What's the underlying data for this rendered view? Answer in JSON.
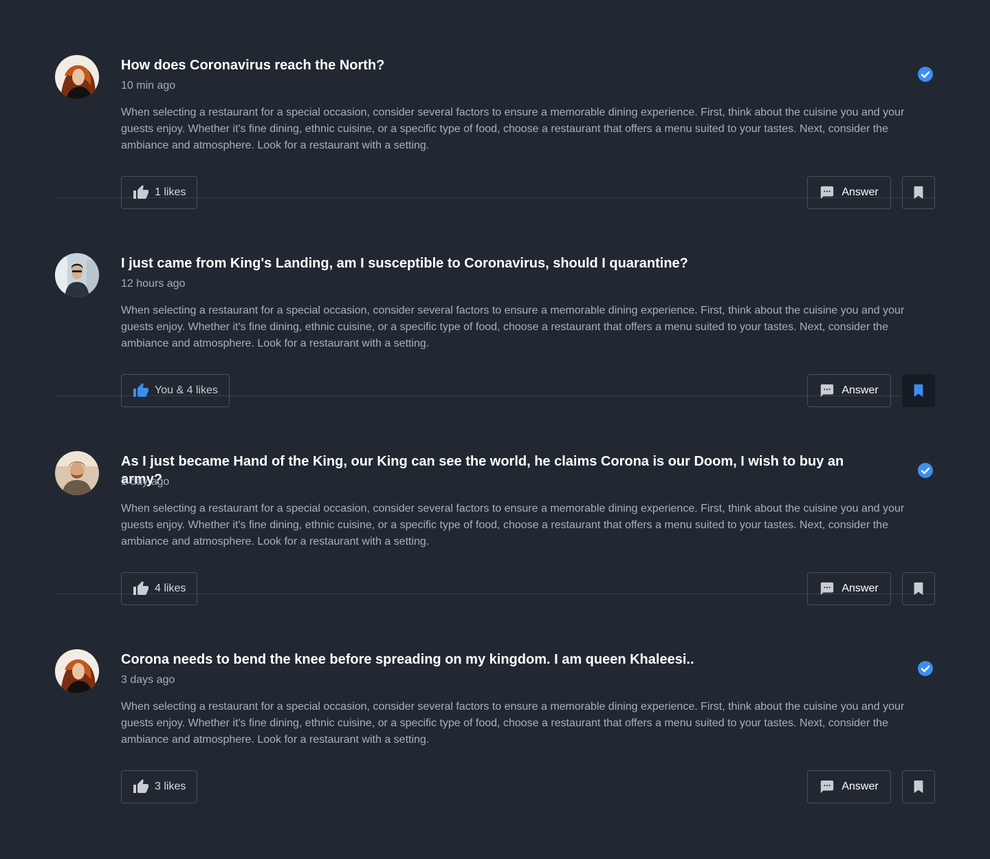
{
  "colors": {
    "background": "#222831",
    "accent": "#3b8ef0",
    "divider": "#3a414b"
  },
  "questions": [
    {
      "title": "How does Coronavirus reach the North?",
      "time": "10 min ago",
      "body": "When selecting a restaurant for a special occasion, consider several factors to ensure a memorable dining experience. First, think about the cuisine you and your guests enjoy. Whether it's fine dining, ethnic cuisine, or a specific type of food, choose a restaurant that offers a menu suited to your tastes. Next, consider the ambiance and atmosphere. Look for a restaurant with a setting.",
      "likes_label": "1 likes",
      "answer_label": "Answer",
      "verified": true,
      "liked": false,
      "bookmarked": false
    },
    {
      "title": "I just came from King's Landing, am I susceptible to Coronavirus, should I quarantine?",
      "time": "12 hours ago",
      "body": "When selecting a restaurant for a special occasion, consider several factors to ensure a memorable dining experience. First, think about the cuisine you and your guests enjoy. Whether it's fine dining, ethnic cuisine, or a specific type of food, choose a restaurant that offers a menu suited to your tastes. Next, consider the ambiance and atmosphere. Look for a restaurant with a setting.",
      "likes_label": "You & 4 likes",
      "answer_label": "Answer",
      "verified": false,
      "liked": true,
      "bookmarked": true
    },
    {
      "title": "As I just became Hand of the King, our King can see the world, he claims Corona is our Doom, I wish to buy an army?",
      "time": "1 day ago",
      "body": "When selecting a restaurant for a special occasion, consider several factors to ensure a memorable dining experience. First, think about the cuisine you and your guests enjoy. Whether it's fine dining, ethnic cuisine, or a specific type of food, choose a restaurant that offers a menu suited to your tastes. Next, consider the ambiance and atmosphere. Look for a restaurant with a setting.",
      "likes_label": "4 likes",
      "answer_label": "Answer",
      "verified": true,
      "liked": false,
      "bookmarked": false
    },
    {
      "title": "Corona needs to bend the knee before spreading on my kingdom. I am queen Khaleesi..",
      "time": "3 days ago",
      "body": "When selecting a restaurant for a special occasion, consider several factors to ensure a memorable dining experience. First, think about the cuisine you and your guests enjoy. Whether it's fine dining, ethnic cuisine, or a specific type of food, choose a restaurant that offers a menu suited to your tastes. Next, consider the ambiance and atmosphere. Look for a restaurant with a setting.",
      "likes_label": "3 likes",
      "answer_label": "Answer",
      "verified": true,
      "liked": false,
      "bookmarked": false
    }
  ]
}
